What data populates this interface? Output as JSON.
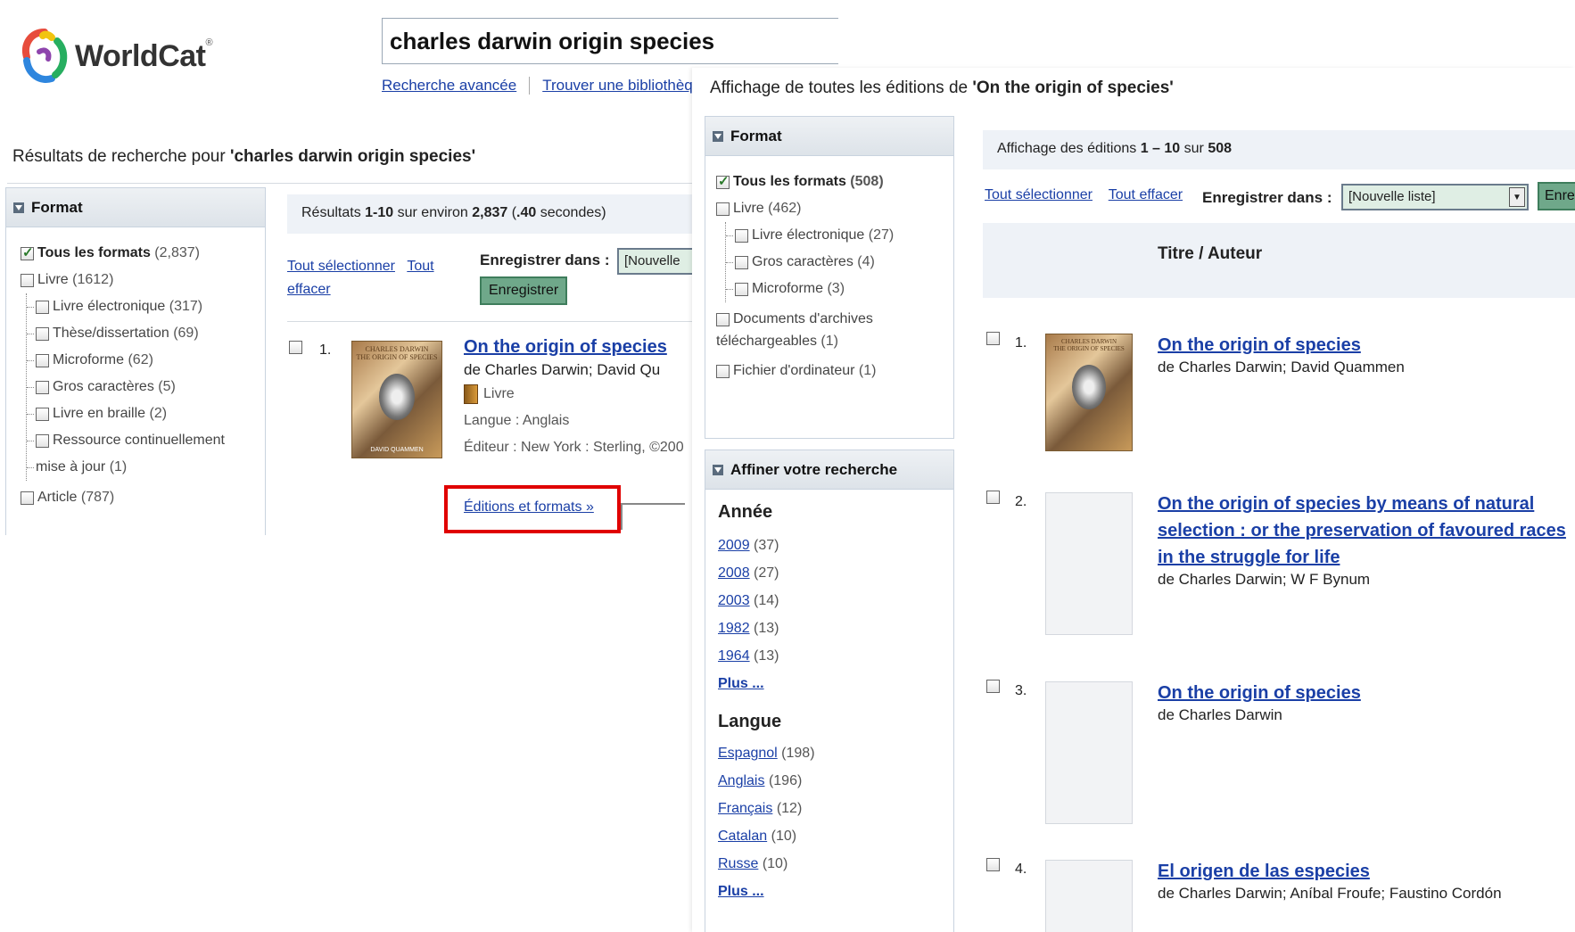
{
  "worldcat": {
    "logo_text": "WorldCat",
    "search_value": "charles darwin origin species",
    "links": [
      "Recherche avancée",
      "Trouver une bibliothèque"
    ],
    "results_heading_prefix": "Résultats de recherche pour ",
    "results_heading_query": "'charles darwin origin species'",
    "format_panel_title": "Format",
    "formats": [
      {
        "label": "Tous les formats",
        "count": "(2,837)",
        "checked": true,
        "level": 0
      },
      {
        "label": "Livre",
        "count": "(1612)",
        "level": 0
      },
      {
        "label": "Livre électronique",
        "count": "(317)",
        "level": 1
      },
      {
        "label": "Thèse/dissertation",
        "count": "(69)",
        "level": 1
      },
      {
        "label": "Microforme",
        "count": "(62)",
        "level": 1
      },
      {
        "label": "Gros caractères",
        "count": "(5)",
        "level": 1
      },
      {
        "label": "Livre en braille",
        "count": "(2)",
        "level": 1
      },
      {
        "label": "Ressource continuellement",
        "count": "",
        "level": 1
      },
      {
        "label": "mise à jour",
        "count": "(1)",
        "level": 1
      },
      {
        "label": "Article",
        "count": "(787)",
        "level": 0
      }
    ],
    "results_summary": {
      "prefix": "Résultats ",
      "range": "1-10",
      "mid": " sur environ ",
      "total": "2,837",
      "time_open": " (",
      "time": ".40",
      "time_close": " secondes)"
    },
    "select_all": "Tout sélectionner",
    "clear_all": "Tout effacer",
    "clear_all_1": "Tout",
    "clear_all_2": "effacer",
    "save_in_label": "Enregistrer dans :",
    "save_in_value": "[Nouvelle",
    "save_button": "Enregistrer",
    "result": {
      "number": "1.",
      "title": "On the origin of species",
      "author": "de Charles Darwin; David Qu",
      "type": "Livre",
      "language": "Langue : Anglais",
      "publisher": "Éditeur : New York : Sterling, ©200",
      "editions_link": "Éditions et formats »",
      "cover_line1": "CHARLES DARWIN",
      "cover_line2": "THE ORIGIN OF SPECIES",
      "cover_line3": "DAVID QUAMMEN"
    }
  },
  "editions": {
    "heading_prefix": "Affichage de toutes les éditions de ",
    "heading_title": "'On the origin of species'",
    "format_panel_title": "Format",
    "formats": [
      {
        "label": "Tous les formats",
        "count": "(508)",
        "checked": true,
        "level": 0
      },
      {
        "label": "Livre",
        "count": "(462)",
        "level": 0
      },
      {
        "label": "Livre électronique",
        "count": "(27)",
        "level": 1
      },
      {
        "label": "Gros caractères",
        "count": "(4)",
        "level": 1
      },
      {
        "label": "Microforme",
        "count": "(3)",
        "level": 1
      },
      {
        "label": "Documents d'archives",
        "count": "",
        "level": 0
      },
      {
        "label": "téléchargeables",
        "count": "(1)",
        "level": 0
      },
      {
        "label": "Fichier d'ordinateur",
        "count": "(1)",
        "level": 0
      }
    ],
    "refine_title": "Affiner votre recherche",
    "year_heading": "Année",
    "years": [
      {
        "label": "2009",
        "count": "(37)"
      },
      {
        "label": "2008",
        "count": "(27)"
      },
      {
        "label": "2003",
        "count": "(14)"
      },
      {
        "label": "1982",
        "count": "(13)"
      },
      {
        "label": "1964",
        "count": "(13)"
      }
    ],
    "more": "Plus ...",
    "lang_heading": "Langue",
    "languages": [
      {
        "label": "Espagnol",
        "count": "(198)"
      },
      {
        "label": "Anglais",
        "count": "(196)"
      },
      {
        "label": "Français",
        "count": "(12)"
      },
      {
        "label": "Catalan",
        "count": "(10)"
      },
      {
        "label": "Russe",
        "count": "(10)"
      }
    ],
    "summary": {
      "prefix": "Affichage des éditions ",
      "range": "1 – 10",
      "mid": " sur ",
      "total": "508"
    },
    "select_all": "Tout sélectionner",
    "clear_all": "Tout effacer",
    "save_in_label": "Enregistrer dans :",
    "save_in_value": "[Nouvelle liste]",
    "save_button": "Enreg",
    "col_header": "Titre / Auteur",
    "items": [
      {
        "number": "1.",
        "title_lines": [
          "On the origin of species"
        ],
        "author": "de Charles Darwin; David Quammen",
        "has_cover": true
      },
      {
        "number": "2.",
        "title_lines": [
          "On the origin of species by means of natural",
          "selection : or the preservation of favoured races",
          "in the struggle for life"
        ],
        "author": "de Charles Darwin; W F Bynum",
        "has_cover": false
      },
      {
        "number": "3.",
        "title_lines": [
          "On the origin of species"
        ],
        "author": "de Charles Darwin",
        "has_cover": false
      },
      {
        "number": "4.",
        "title_lines": [
          "El origen de las especies"
        ],
        "author": "de Charles Darwin; Aníbal Froufe; Faustino Cordón",
        "has_cover": false
      }
    ]
  },
  "colors": {
    "link": "#1a3fa6",
    "highlight_box": "#e00000",
    "button_bg": "#6fa88a",
    "panel_head": "#dde3e9"
  }
}
